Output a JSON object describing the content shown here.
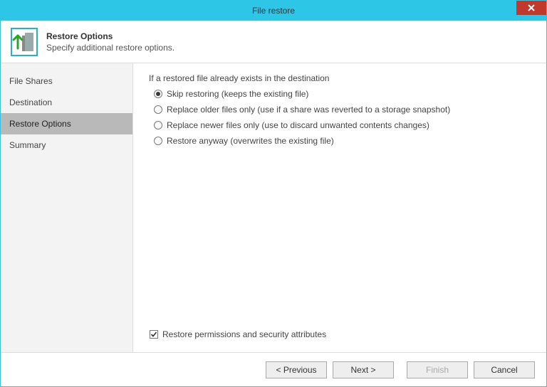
{
  "window": {
    "title": "File restore"
  },
  "header": {
    "title": "Restore Options",
    "subtitle": "Specify additional restore options."
  },
  "sidebar": {
    "items": [
      {
        "label": "File Shares"
      },
      {
        "label": "Destination"
      },
      {
        "label": "Restore Options"
      },
      {
        "label": "Summary"
      }
    ]
  },
  "content": {
    "section_label": "If a restored file already exists in the destination",
    "radios": [
      {
        "label": "Skip restoring (keeps the existing file)",
        "selected": true
      },
      {
        "label": "Replace older files only (use if a share was reverted to a storage snapshot)",
        "selected": false
      },
      {
        "label": "Replace newer files only (use to discard unwanted contents changes)",
        "selected": false
      },
      {
        "label": "Restore anyway (overwrites the existing file)",
        "selected": false
      }
    ],
    "checkbox": {
      "label": "Restore permissions and security attributes",
      "checked": true
    }
  },
  "footer": {
    "previous": "< Previous",
    "next": "Next >",
    "finish": "Finish",
    "cancel": "Cancel"
  }
}
